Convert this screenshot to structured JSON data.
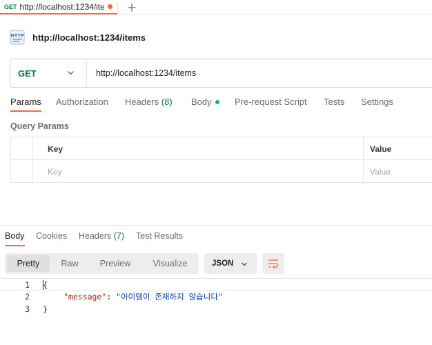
{
  "tab": {
    "method": "GET",
    "title": "http://localhost:1234/ite"
  },
  "request": {
    "name": "http://localhost:1234/items",
    "method": "GET",
    "url": "http://localhost:1234/items"
  },
  "request_tabs": [
    {
      "label": "Params"
    },
    {
      "label": "Authorization"
    },
    {
      "label": "Headers",
      "count": "(8)"
    },
    {
      "label": "Body"
    },
    {
      "label": "Pre-request Script"
    },
    {
      "label": "Tests"
    },
    {
      "label": "Settings"
    }
  ],
  "query_params": {
    "title": "Query Params",
    "header_key": "Key",
    "header_value": "Value",
    "key_placeholder": "Key",
    "value_placeholder": "Value"
  },
  "response_tabs": [
    {
      "label": "Body"
    },
    {
      "label": "Cookies"
    },
    {
      "label": "Headers",
      "count": "(7)"
    },
    {
      "label": "Test Results"
    }
  ],
  "view_modes": [
    {
      "label": "Pretty"
    },
    {
      "label": "Raw"
    },
    {
      "label": "Preview"
    },
    {
      "label": "Visualize"
    }
  ],
  "format": "JSON",
  "code": {
    "line_numbers": [
      "1",
      "2",
      "3"
    ],
    "open_brace": "{",
    "key": "\"message\"",
    "colon": ": ",
    "value": "\"아이템이 존재하지 않습니다\"",
    "close_brace": "}"
  },
  "colors": {
    "accent": "#f26b3a",
    "method_get": "#0b7a3e",
    "body_dot": "#0cbb52",
    "json_key": "#a1260d",
    "json_string": "#0b3fa8"
  }
}
